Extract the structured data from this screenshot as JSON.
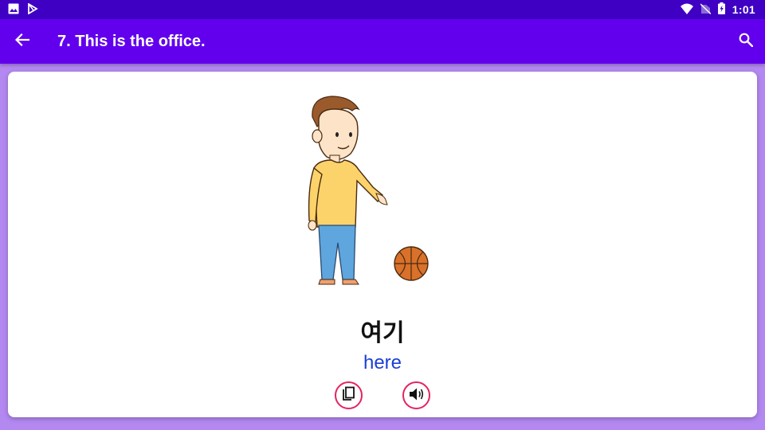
{
  "status_bar": {
    "time": "1:01",
    "left_icons": [
      "image-icon",
      "play-store-icon"
    ],
    "right_icons": [
      "wifi-icon",
      "no-sim-icon",
      "battery-charging-icon"
    ]
  },
  "app_bar": {
    "title": "7. This is the office.",
    "back_icon": "arrow-back-icon",
    "search_icon": "search-icon",
    "color": "#6200ee"
  },
  "card": {
    "illustration": "boy-pointing-at-basketball",
    "word": "여기",
    "meaning": "here",
    "actions": [
      {
        "name": "copy",
        "icon": "copy-icon"
      },
      {
        "name": "speak",
        "icon": "speaker-icon"
      }
    ],
    "accent_color": "#e3245e",
    "meaning_color": "#1a3fd6"
  }
}
